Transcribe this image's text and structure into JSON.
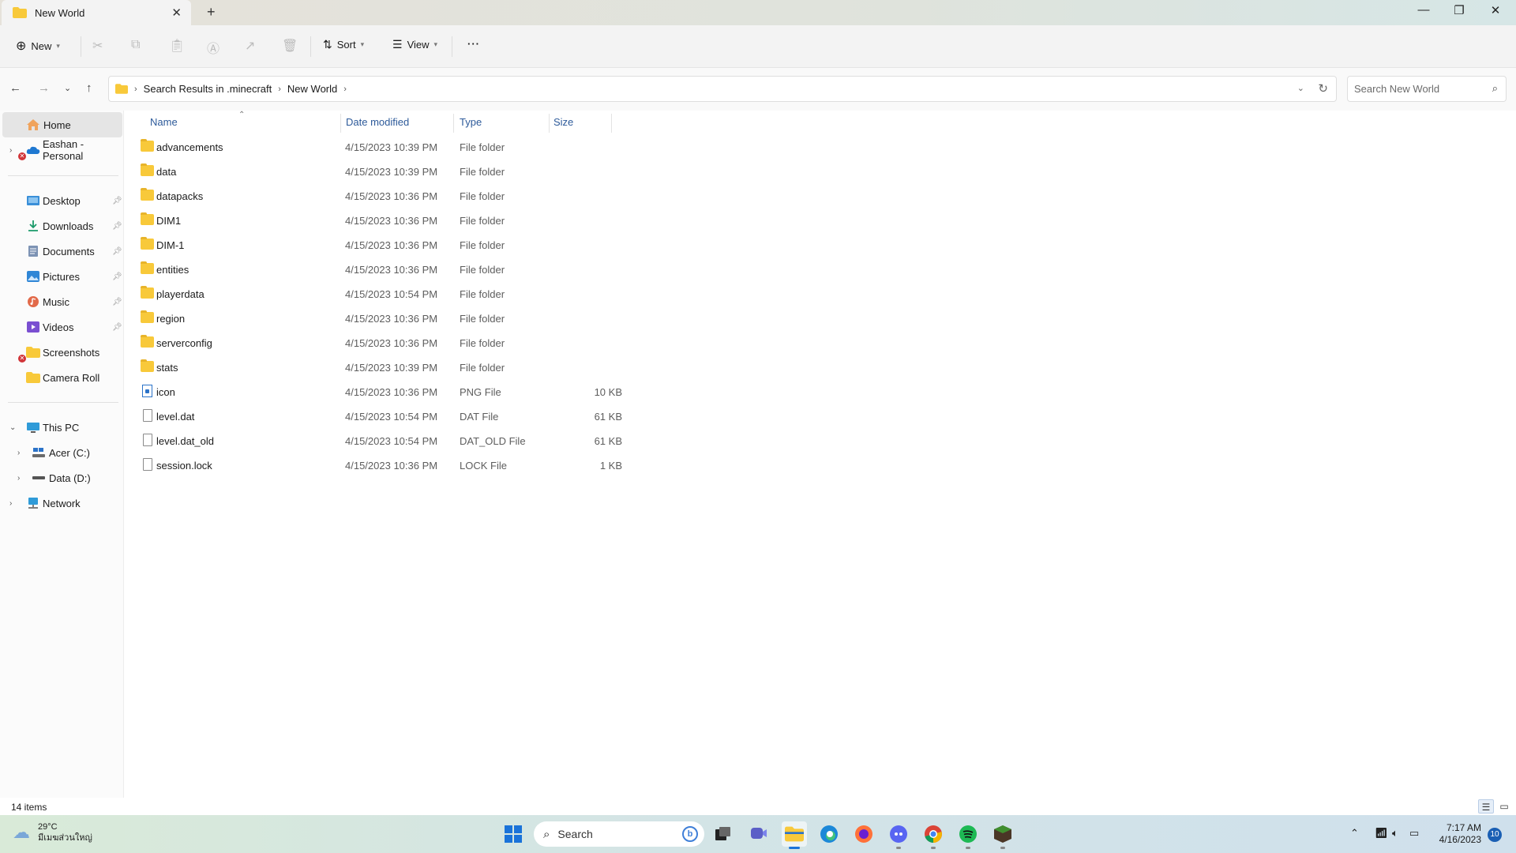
{
  "window": {
    "tab_title": "New World",
    "tab_close": "✕",
    "new_tab": "+",
    "minimize": "—",
    "maximize": "❐",
    "close": "✕"
  },
  "commandbar": {
    "new_label": "New",
    "sort_label": "Sort",
    "view_label": "View",
    "more_label": "···"
  },
  "address": {
    "crumbs": [
      "Search Results in .minecraft",
      "New World"
    ],
    "search_placeholder": "Search New World"
  },
  "sidebar": {
    "home": "Home",
    "onedrive": "Eashan - Personal",
    "quick": [
      {
        "label": "Desktop",
        "icon": "desktop-icon"
      },
      {
        "label": "Downloads",
        "icon": "downloads-icon"
      },
      {
        "label": "Documents",
        "icon": "documents-icon"
      },
      {
        "label": "Pictures",
        "icon": "pictures-icon"
      },
      {
        "label": "Music",
        "icon": "music-icon"
      },
      {
        "label": "Videos",
        "icon": "videos-icon"
      },
      {
        "label": "Screenshots",
        "icon": "folder-icon"
      },
      {
        "label": "Camera Roll",
        "icon": "folder-icon"
      }
    ],
    "this_pc": "This PC",
    "drive_c": "Acer (C:)",
    "drive_d": "Data  (D:)",
    "network": "Network"
  },
  "columns": {
    "name": "Name",
    "date": "Date modified",
    "type": "Type",
    "size": "Size"
  },
  "files": [
    {
      "name": "advancements",
      "date": "4/15/2023 10:39 PM",
      "type": "File folder",
      "size": "",
      "kind": "folder"
    },
    {
      "name": "data",
      "date": "4/15/2023 10:39 PM",
      "type": "File folder",
      "size": "",
      "kind": "folder"
    },
    {
      "name": "datapacks",
      "date": "4/15/2023 10:36 PM",
      "type": "File folder",
      "size": "",
      "kind": "folder"
    },
    {
      "name": "DIM1",
      "date": "4/15/2023 10:36 PM",
      "type": "File folder",
      "size": "",
      "kind": "folder"
    },
    {
      "name": "DIM-1",
      "date": "4/15/2023 10:36 PM",
      "type": "File folder",
      "size": "",
      "kind": "folder"
    },
    {
      "name": "entities",
      "date": "4/15/2023 10:36 PM",
      "type": "File folder",
      "size": "",
      "kind": "folder"
    },
    {
      "name": "playerdata",
      "date": "4/15/2023 10:54 PM",
      "type": "File folder",
      "size": "",
      "kind": "folder"
    },
    {
      "name": "region",
      "date": "4/15/2023 10:36 PM",
      "type": "File folder",
      "size": "",
      "kind": "folder"
    },
    {
      "name": "serverconfig",
      "date": "4/15/2023 10:36 PM",
      "type": "File folder",
      "size": "",
      "kind": "folder"
    },
    {
      "name": "stats",
      "date": "4/15/2023 10:39 PM",
      "type": "File folder",
      "size": "",
      "kind": "folder"
    },
    {
      "name": "icon",
      "date": "4/15/2023 10:36 PM",
      "type": "PNG File",
      "size": "10 KB",
      "kind": "png"
    },
    {
      "name": "level.dat",
      "date": "4/15/2023 10:54 PM",
      "type": "DAT File",
      "size": "61 KB",
      "kind": "file"
    },
    {
      "name": "level.dat_old",
      "date": "4/15/2023 10:54 PM",
      "type": "DAT_OLD File",
      "size": "61 KB",
      "kind": "file"
    },
    {
      "name": "session.lock",
      "date": "4/15/2023 10:36 PM",
      "type": "LOCK File",
      "size": "1 KB",
      "kind": "file"
    }
  ],
  "status": {
    "count": "14 items"
  },
  "taskbar": {
    "temperature": "29°C",
    "location": "มีเมฆส่วนใหญ่",
    "search_label": "Search",
    "time": "7:17 AM",
    "date": "4/16/2023",
    "notifications": "10"
  },
  "colors": {
    "folder": "#f8c93a",
    "accent": "#1a73d9",
    "header_text": "#2d5a9a"
  }
}
